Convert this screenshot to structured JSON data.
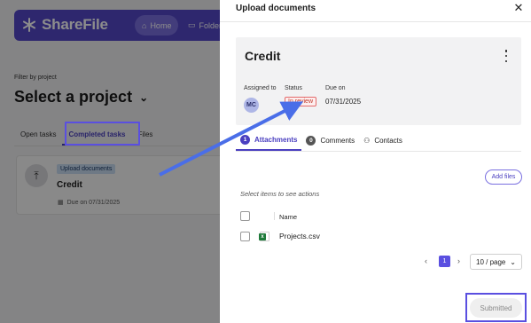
{
  "app": {
    "brand": "ShareFile",
    "nav": {
      "home": "Home",
      "folders": "Folders"
    },
    "filter_label": "Filter by project",
    "project_select": "Select a project",
    "tabs": [
      "Open tasks",
      "Completed tasks",
      "Files"
    ],
    "task_card": {
      "badge": "Upload documents",
      "title": "Credit",
      "due": "Due on 07/31/2025"
    }
  },
  "drawer": {
    "title": "Upload documents",
    "task": {
      "title": "Credit",
      "assigned_label": "Assigned to",
      "assignee_initials": "MC",
      "status_label": "Status",
      "status_value": "In review",
      "due_label": "Due on",
      "due_value": "07/31/2025"
    },
    "tabs": [
      {
        "count": "1",
        "label": "Attachments"
      },
      {
        "count": "0",
        "label": "Comments"
      },
      {
        "label": "Contacts"
      }
    ],
    "add_files": "Add files",
    "select_hint": "Select items to see actions",
    "table": {
      "name_header": "Name",
      "rows": [
        {
          "name": "Projects.csv"
        }
      ]
    },
    "pagination": {
      "current_page": "1",
      "per_page": "10 / page"
    },
    "submit_label": "Submitted"
  },
  "colors": {
    "accent": "#5447c9",
    "status_red": "#c0392b",
    "highlight": "#5a4fe0"
  }
}
